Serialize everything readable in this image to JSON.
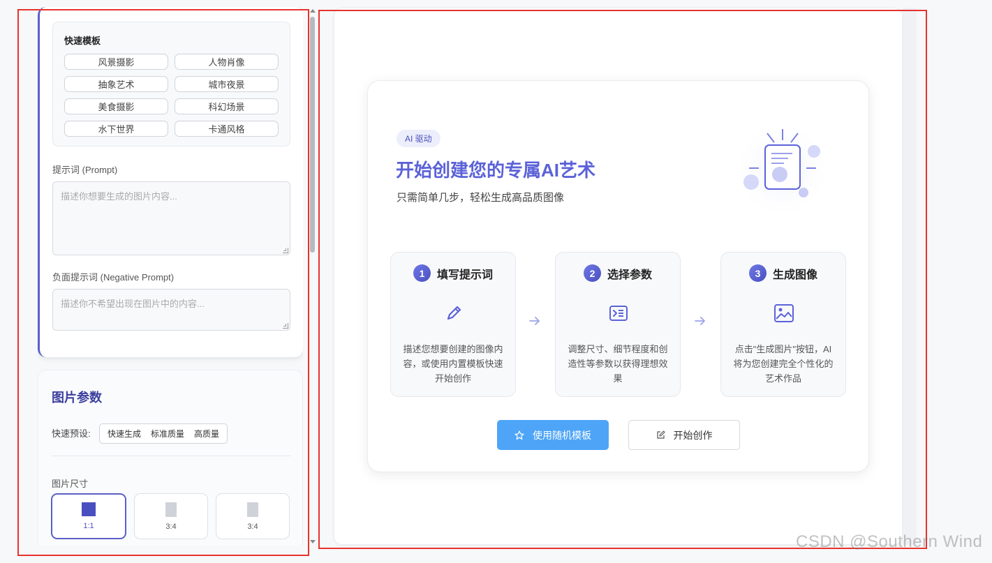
{
  "templates": {
    "title": "快速模板",
    "items": [
      "风景摄影",
      "人物肖像",
      "抽象艺术",
      "城市夜景",
      "美食摄影",
      "科幻场景",
      "水下世界",
      "卡通风格"
    ]
  },
  "prompt": {
    "label": "提示词 (Prompt)",
    "placeholder": "描述你想要生成的图片内容..."
  },
  "negative_prompt": {
    "label": "负面提示词 (Negative Prompt)",
    "placeholder": "描述你不希望出现在图片中的内容..."
  },
  "image_params": {
    "title": "图片参数",
    "preset_label": "快速预设:",
    "presets": [
      "快速生成",
      "标准质量",
      "高质量"
    ],
    "size_label": "图片尺寸",
    "ratios": [
      {
        "label": "1:1",
        "selected": true
      },
      {
        "label": "3:4",
        "selected": false
      },
      {
        "label": "3:4",
        "selected": false
      }
    ]
  },
  "welcome": {
    "badge": "AI 驱动",
    "title": "开始创建您的专属AI艺术",
    "subtitle": "只需简单几步，轻松生成高品质图像",
    "steps": [
      {
        "num": "1",
        "title": "填写提示词",
        "icon": "pencil-icon",
        "desc": "描述您想要创建的图像内容，或使用内置模板快速开始创作"
      },
      {
        "num": "2",
        "title": "选择参数",
        "icon": "terminal-settings-icon",
        "desc": "调整尺寸、细节程度和创造性等参数以获得理想效果"
      },
      {
        "num": "3",
        "title": "生成图像",
        "icon": "image-icon",
        "desc": "点击\"生成图片\"按钮，AI将为您创建完全个性化的艺术作品"
      }
    ],
    "random_button": "使用随机模板",
    "start_button": "开始创作"
  },
  "watermark": "CSDN @Southern Wind",
  "colors": {
    "accent": "#5b5fc7",
    "primary_button": "#4ea5f7",
    "annotation_frame": "#e8322d"
  }
}
